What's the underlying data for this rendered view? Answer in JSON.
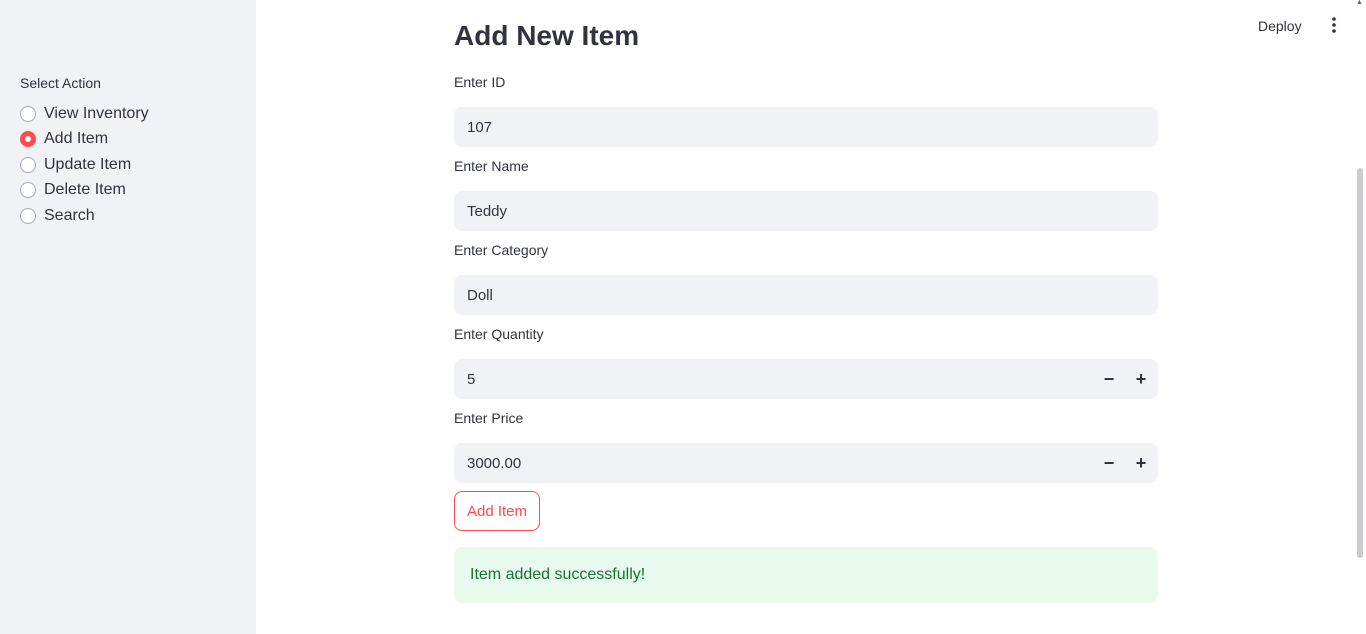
{
  "header": {
    "deploy_label": "Deploy",
    "menu_icon": "more-vertical-icon"
  },
  "sidebar": {
    "label": "Select Action",
    "options": [
      {
        "label": "View Inventory",
        "selected": false
      },
      {
        "label": "Add Item",
        "selected": true
      },
      {
        "label": "Update Item",
        "selected": false
      },
      {
        "label": "Delete Item",
        "selected": false
      },
      {
        "label": "Search",
        "selected": false
      }
    ]
  },
  "main": {
    "title": "Add New Item",
    "fields": {
      "id": {
        "label": "Enter ID",
        "value": "107"
      },
      "name": {
        "label": "Enter Name",
        "value": "Teddy"
      },
      "category": {
        "label": "Enter Category",
        "value": "Doll"
      },
      "quantity": {
        "label": "Enter Quantity",
        "value": "5",
        "minus": "−",
        "plus": "+"
      },
      "price": {
        "label": "Enter Price",
        "value": "3000.00",
        "minus": "−",
        "plus": "+"
      }
    },
    "submit_label": "Add Item",
    "success_message": "Item added successfully!"
  },
  "colors": {
    "accent": "#ff4b4b",
    "sidebar_bg": "#f0f2f6",
    "success_bg": "#e8f9ee",
    "success_text": "#177233"
  }
}
